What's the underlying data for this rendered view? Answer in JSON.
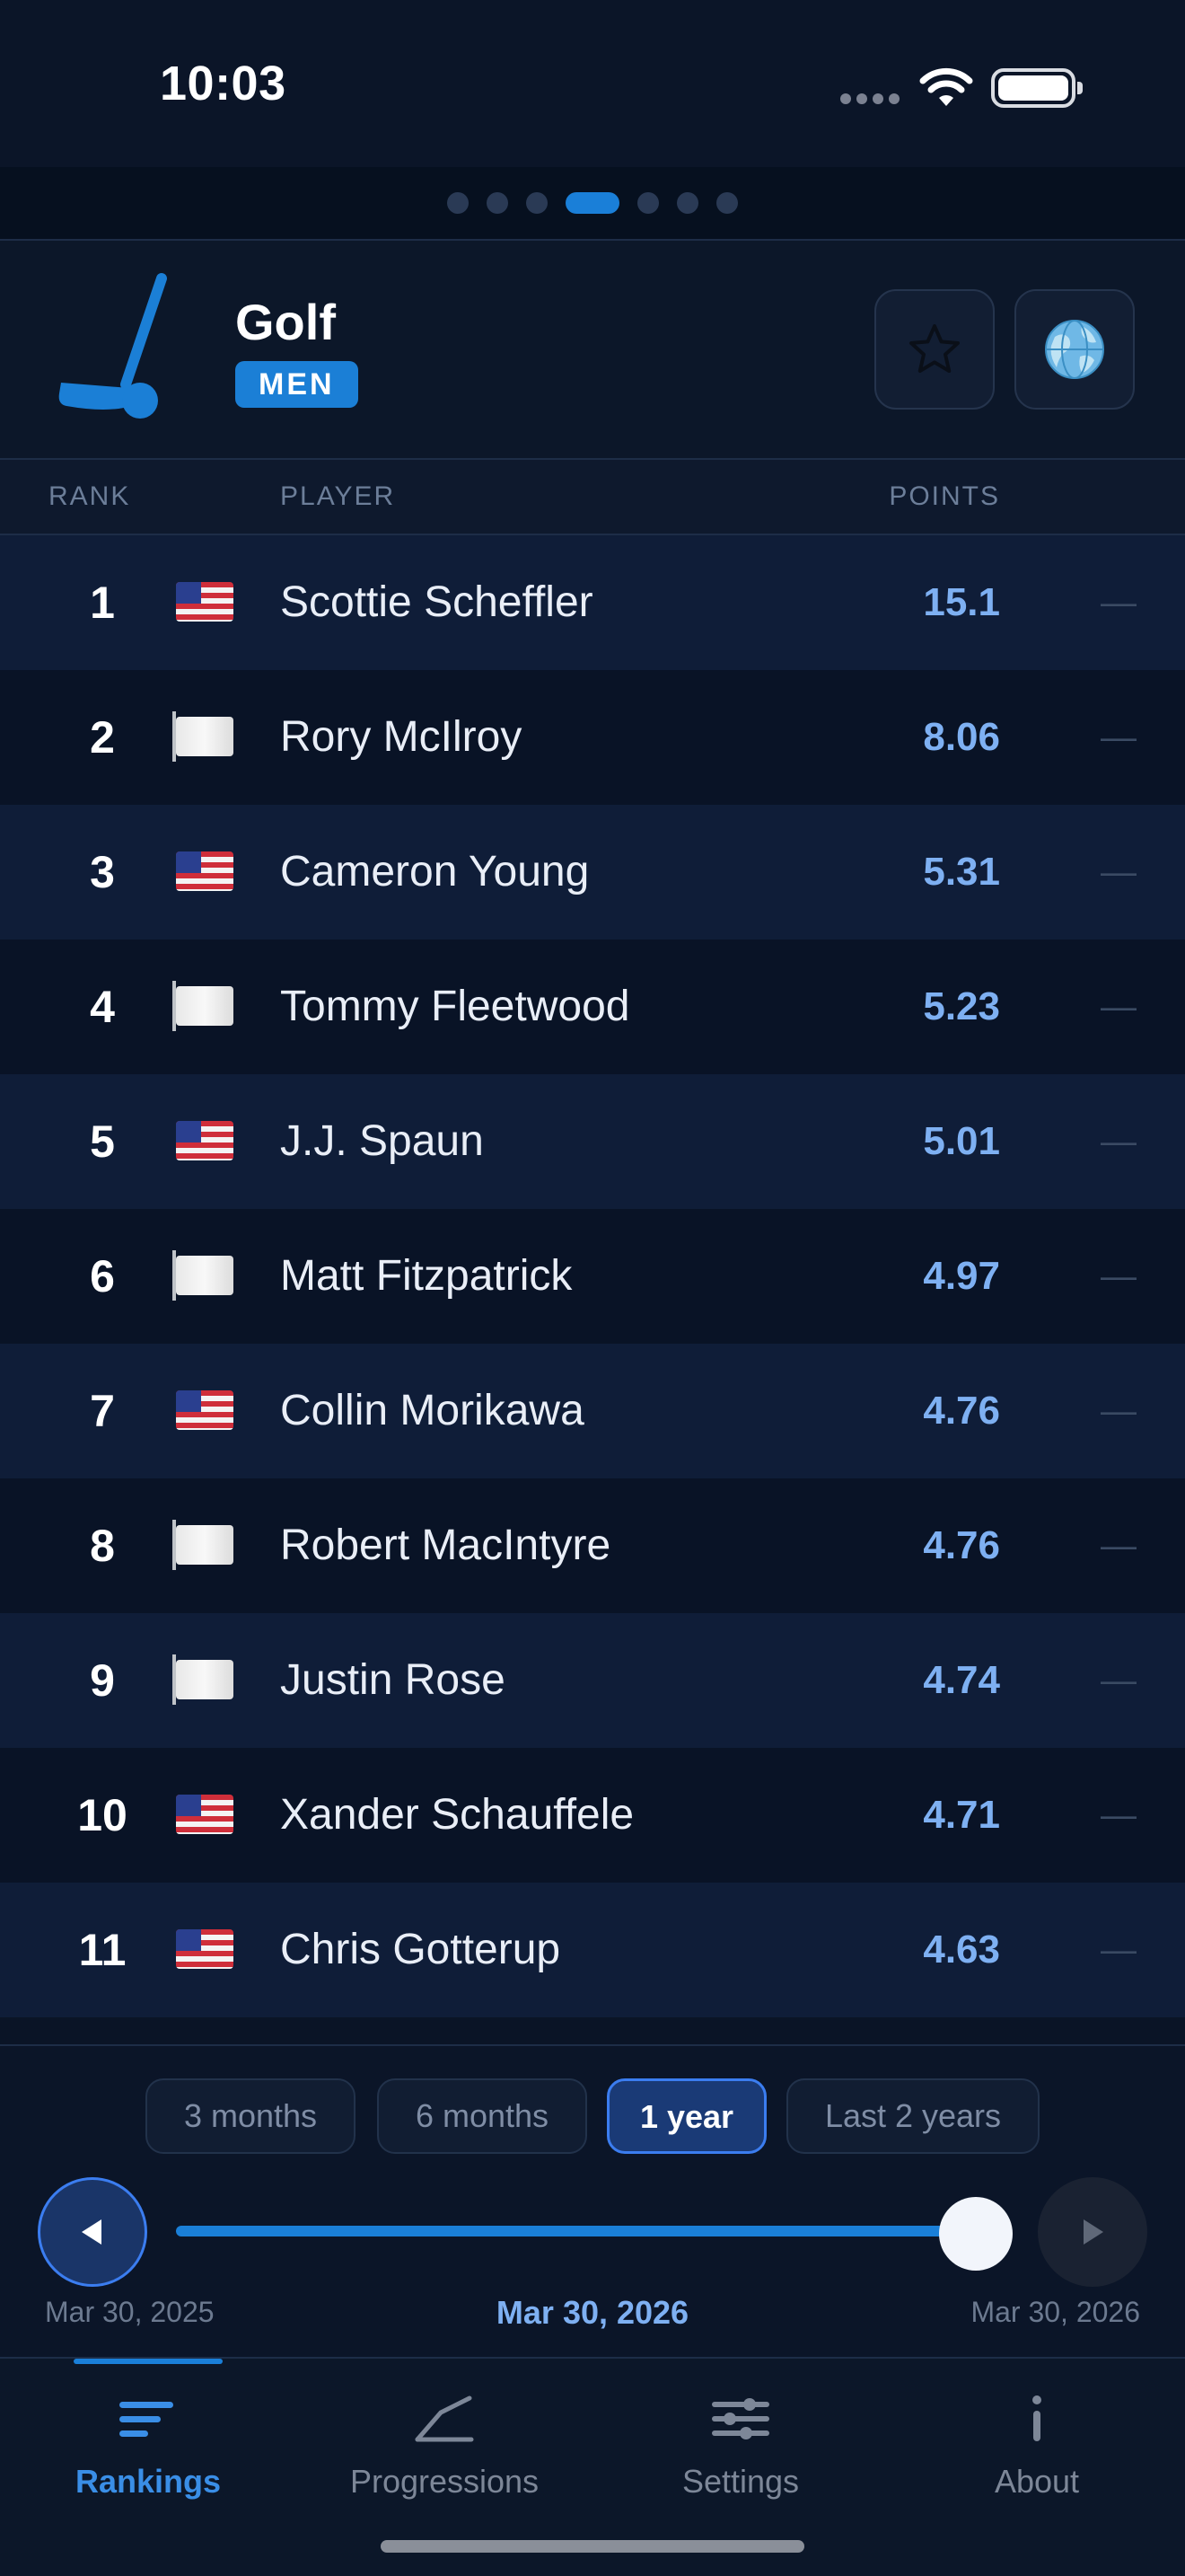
{
  "status_bar": {
    "time": "10:03"
  },
  "pager": {
    "total": 7,
    "active_index": 3
  },
  "header": {
    "icon": "golf-club-icon",
    "sport": "Golf",
    "gender": "MEN",
    "actions": [
      {
        "name": "favorite-button",
        "icon": "star-icon"
      },
      {
        "name": "region-button",
        "icon": "globe-icon"
      }
    ]
  },
  "table": {
    "columns": {
      "rank": "RANK",
      "player": "PLAYER",
      "points": "POINTS"
    },
    "rows": [
      {
        "rank": "1",
        "flag": "us",
        "player": "Scottie Scheffler",
        "points": "15.1",
        "trend": "—"
      },
      {
        "rank": "2",
        "flag": "white",
        "player": "Rory McIlroy",
        "points": "8.06",
        "trend": "—"
      },
      {
        "rank": "3",
        "flag": "us",
        "player": "Cameron Young",
        "points": "5.31",
        "trend": "—"
      },
      {
        "rank": "4",
        "flag": "white",
        "player": "Tommy Fleetwood",
        "points": "5.23",
        "trend": "—"
      },
      {
        "rank": "5",
        "flag": "us",
        "player": "J.J. Spaun",
        "points": "5.01",
        "trend": "—"
      },
      {
        "rank": "6",
        "flag": "white",
        "player": "Matt Fitzpatrick",
        "points": "4.97",
        "trend": "—"
      },
      {
        "rank": "7",
        "flag": "us",
        "player": "Collin Morikawa",
        "points": "4.76",
        "trend": "—"
      },
      {
        "rank": "8",
        "flag": "white",
        "player": "Robert MacIntyre",
        "points": "4.76",
        "trend": "—"
      },
      {
        "rank": "9",
        "flag": "white",
        "player": "Justin Rose",
        "points": "4.74",
        "trend": "—"
      },
      {
        "rank": "10",
        "flag": "us",
        "player": "Xander Schauffele",
        "points": "4.71",
        "trend": "—"
      },
      {
        "rank": "11",
        "flag": "us",
        "player": "Chris Gotterup",
        "points": "4.63",
        "trend": "—"
      }
    ]
  },
  "period": {
    "options": [
      "3 months",
      "6 months",
      "1 year",
      "Last 2 years"
    ],
    "selected": "1 year"
  },
  "timeline": {
    "start_label": "Mar 30, 2025",
    "current_label": "Mar 30, 2026",
    "end_label": "Mar 30, 2026",
    "position_fraction": 1.0,
    "prev_icon": "play-left-icon",
    "next_icon": "play-right-icon"
  },
  "tabbar": {
    "tabs": [
      {
        "label": "Rankings",
        "icon": "list-icon",
        "active": true
      },
      {
        "label": "Progressions",
        "icon": "line-chart-icon",
        "active": false
      },
      {
        "label": "Settings",
        "icon": "sliders-icon",
        "active": false
      },
      {
        "label": "About",
        "icon": "info-icon",
        "active": false
      }
    ]
  },
  "colors": {
    "accent": "#1a7fd8",
    "points_text": "#7eb0f2",
    "row_odd": "#0f1d38",
    "row_even": "#091326",
    "background": "#0a1426"
  }
}
